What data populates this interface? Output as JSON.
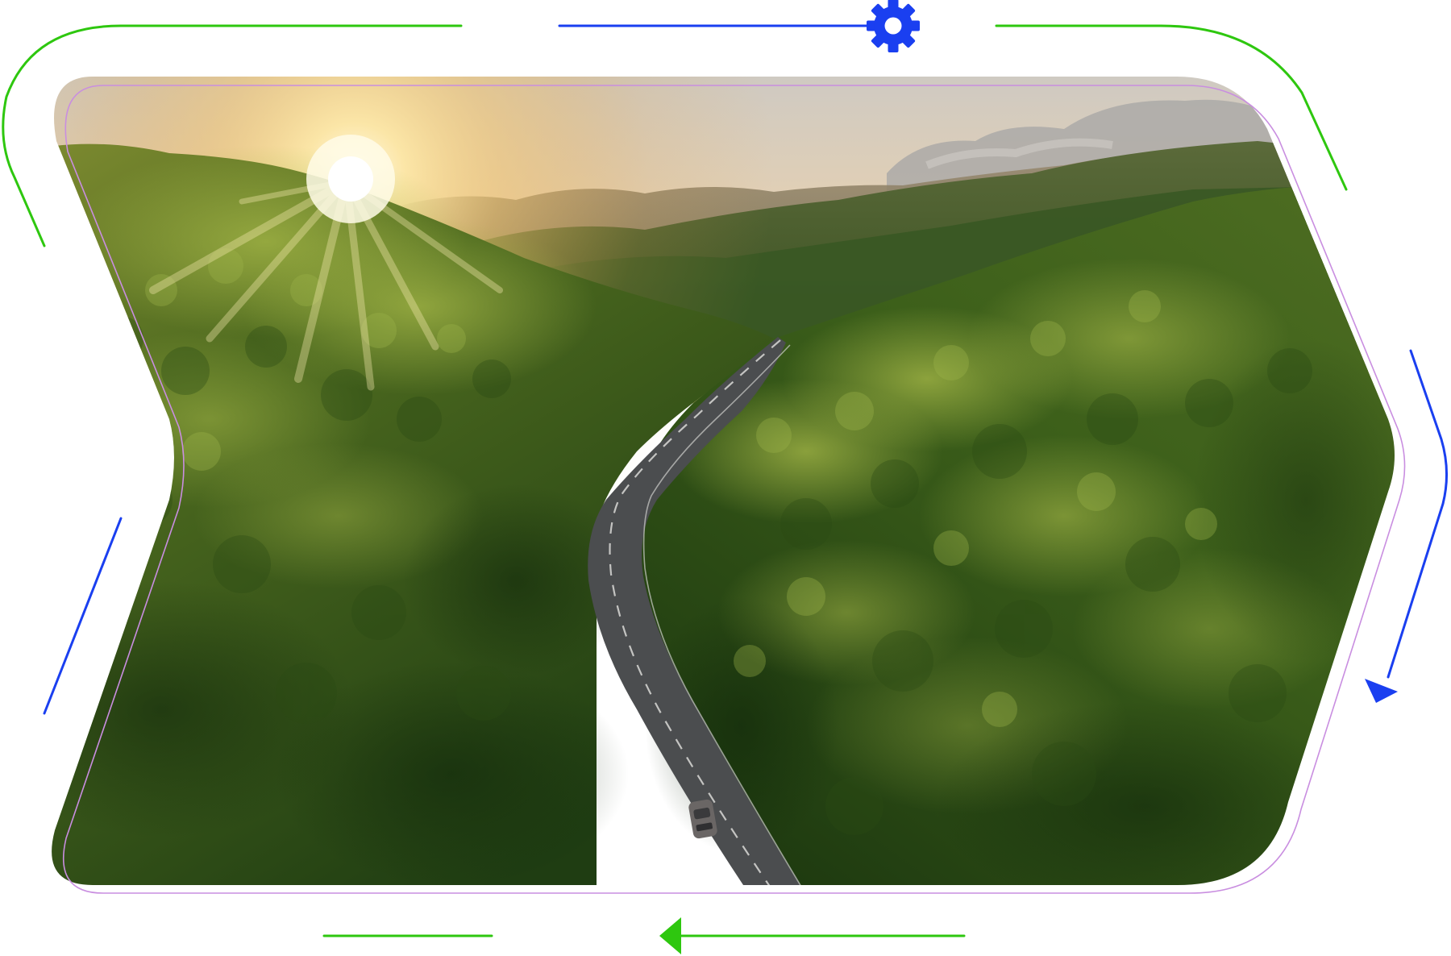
{
  "scene": {
    "subject": "aerial-forest-road-at-sunrise",
    "icons": {
      "top": "gear-icon",
      "right": "arrow-down-left-icon",
      "bottom": "arrow-left-icon"
    },
    "colors": {
      "accent_green": "#2ec70f",
      "accent_blue": "#1a3ff0",
      "outline_violet": "#c98ee0",
      "forest_dark": "#1f3d12",
      "forest_mid": "#3f6a1e",
      "forest_light": "#8fa636",
      "sun": "#fff4c2",
      "sky_top": "#c7c3bd",
      "sky_glow": "#f6d39a",
      "road": "#4b4d4f"
    }
  }
}
